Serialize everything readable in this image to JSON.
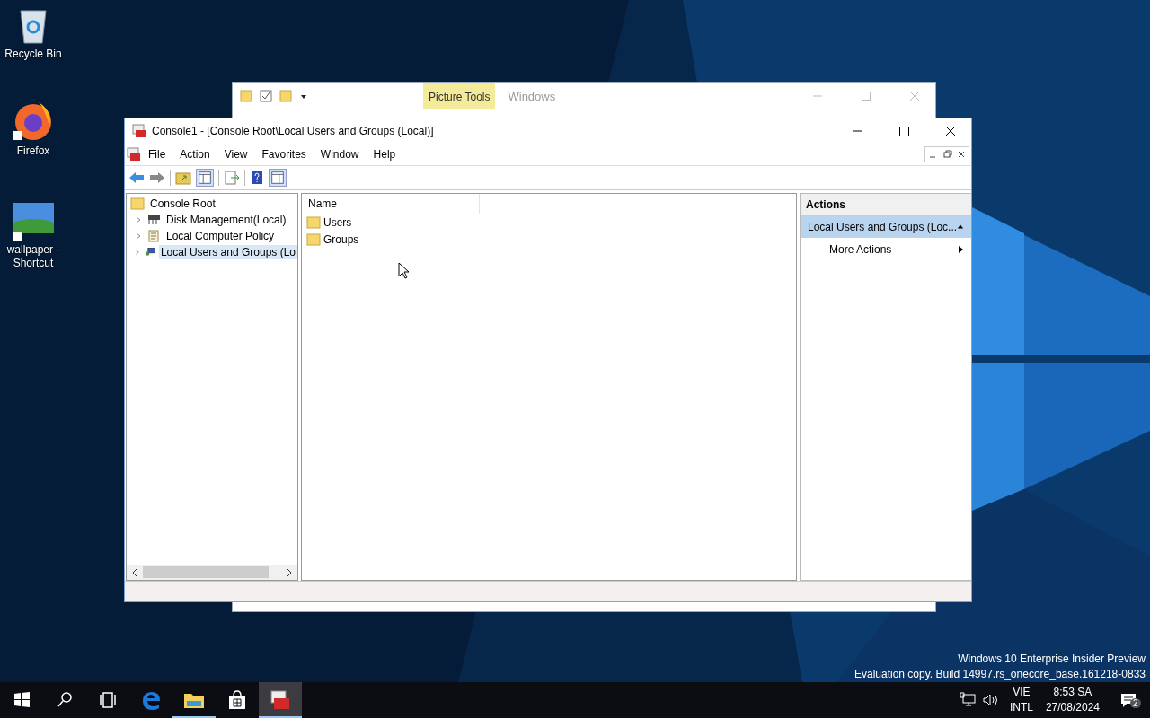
{
  "desktop_icons": [
    {
      "label": "Recycle Bin",
      "kind": "recycle"
    },
    {
      "label": "Firefox",
      "kind": "firefox"
    },
    {
      "label": "wallpaper - Shortcut"
    }
  ],
  "background_window": {
    "contextual_tab": "Picture Tools",
    "title": "Windows"
  },
  "window": {
    "title": "Console1 - [Console Root\\Local Users and Groups (Local)]",
    "menu": [
      "File",
      "Action",
      "View",
      "Favorites",
      "Window",
      "Help"
    ]
  },
  "tree": {
    "label": "Console Root",
    "children": [
      {
        "label": "Disk Management(Local)",
        "kind": "disk",
        "expanded": false,
        "selected": false
      },
      {
        "label": "Local Computer Policy",
        "kind": "policy",
        "expanded": false,
        "selected": false
      },
      {
        "label": "Local Users and Groups (Lo",
        "kind": "users",
        "expanded": false,
        "selected": true
      }
    ]
  },
  "list": {
    "columns": [
      "Name"
    ],
    "items": [
      "Users",
      "Groups"
    ]
  },
  "actions": {
    "title": "Actions",
    "section": {
      "label": "Local Users and Groups (Loc...",
      "expanded": true
    },
    "items": [
      {
        "label": "More Actions",
        "submenu": true
      }
    ]
  },
  "os_notice": [
    "Windows 10 Enterprise Insider Preview",
    "Evaluation copy. Build 14997.rs_onecore_base.161218-0833"
  ],
  "taskbar": {
    "apps": [
      {
        "kind": "edge",
        "running": false,
        "selected": false
      },
      {
        "kind": "explorer",
        "running": true,
        "selected": false
      },
      {
        "kind": "store",
        "running": false,
        "selected": false
      },
      {
        "kind": "console",
        "running": true,
        "selected": true
      }
    ],
    "language": [
      "VIE",
      "INTL"
    ],
    "time": "8:53 SA",
    "date": "27/08/2024",
    "notifications": "2"
  }
}
